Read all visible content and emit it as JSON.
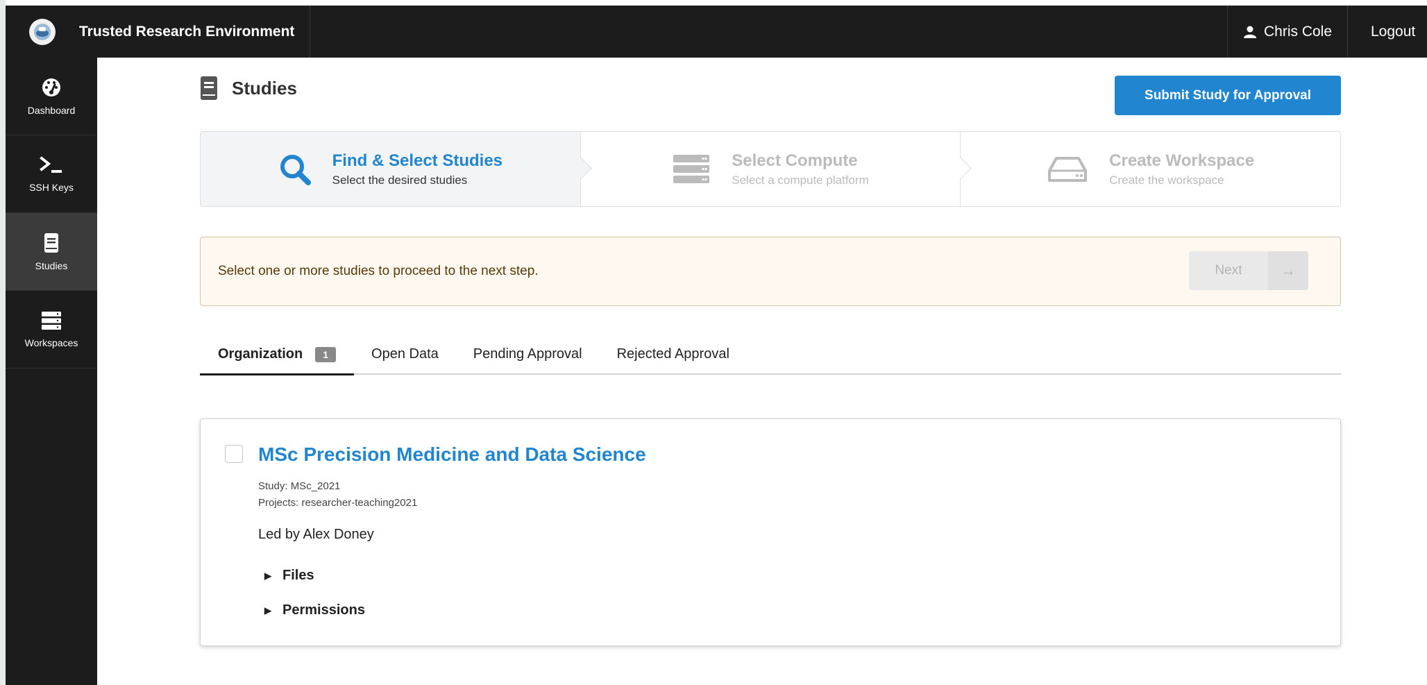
{
  "app": {
    "title": "Trusted Research Environment"
  },
  "header": {
    "user_name": "Chris Cole",
    "logout_label": "Logout"
  },
  "sidebar": {
    "items": [
      {
        "label": "Dashboard",
        "icon": "dashboard-icon",
        "active": false
      },
      {
        "label": "SSH Keys",
        "icon": "terminal-icon",
        "active": false
      },
      {
        "label": "Studies",
        "icon": "book-icon",
        "active": true
      },
      {
        "label": "Workspaces",
        "icon": "server-icon",
        "active": false
      }
    ]
  },
  "page": {
    "title": "Studies",
    "submit_label": "Submit Study for Approval"
  },
  "steps": [
    {
      "title": "Find & Select Studies",
      "description": "Select the desired studies",
      "icon": "search-icon",
      "active": true
    },
    {
      "title": "Select Compute",
      "description": "Select a compute platform",
      "icon": "server-icon",
      "active": false
    },
    {
      "title": "Create Workspace",
      "description": "Create the workspace",
      "icon": "hdd-icon",
      "active": false
    }
  ],
  "message": {
    "text": "Select one or more studies to proceed to the next step.",
    "next_label": "Next",
    "next_icon": "arrow-right-icon"
  },
  "tabs": [
    {
      "label": "Organization",
      "count": "1",
      "active": true
    },
    {
      "label": "Open Data"
    },
    {
      "label": "Pending Approval"
    },
    {
      "label": "Rejected Approval"
    }
  ],
  "study": {
    "title": "MSc Precision Medicine and Data Science",
    "study_id": "Study: MSc_2021",
    "projects": "Projects: researcher-teaching2021",
    "lead": "Led by Alex Doney",
    "files_label": "Files",
    "permissions_label": "Permissions"
  },
  "colors": {
    "primary": "#2185d0",
    "topbar": "#1c1c1c",
    "message_bg": "#fff8f0",
    "message_text": "#573a08"
  }
}
